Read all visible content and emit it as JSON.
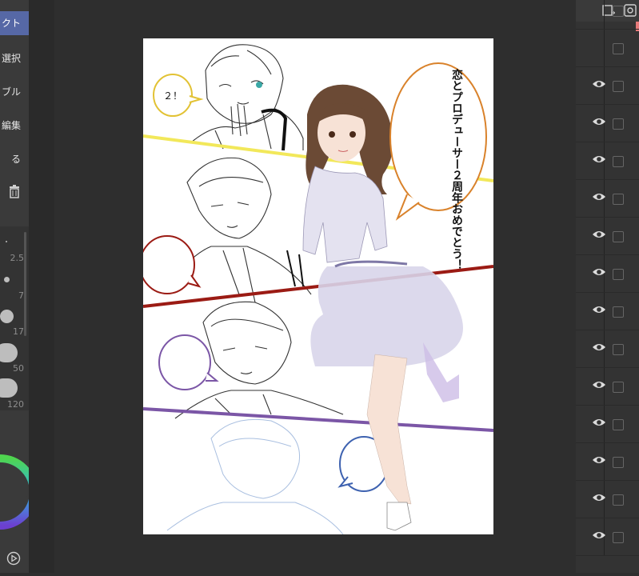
{
  "left_menu": {
    "items": [
      {
        "label": "クト",
        "selected": true
      },
      {
        "label": "選択",
        "selected": false
      },
      {
        "label": "ブル",
        "selected": false
      },
      {
        "label": "編集",
        "selected": false
      },
      {
        "label": "る",
        "selected": false
      }
    ]
  },
  "brush_sizes": [
    "2.5",
    "7",
    "17",
    "50",
    "120"
  ],
  "icons": {
    "trash": "trash-icon",
    "play": "play-icon",
    "add_layer": "add-layer-icon",
    "layer_settings": "layer-settings-icon",
    "visibility": "eye-icon"
  },
  "canvas": {
    "bubble_small": "２！",
    "bubble_main": "恋とプロデューサー２周年おめでとう！"
  },
  "layers_visible_count": 13,
  "colors": {
    "accent": "#5668a6",
    "yellow_line": "#f2e85a",
    "red_line": "#9b1b14",
    "purple_line": "#7b56a6",
    "orange_bubble": "#d9822b",
    "blue_bubble": "#3e62b0"
  }
}
